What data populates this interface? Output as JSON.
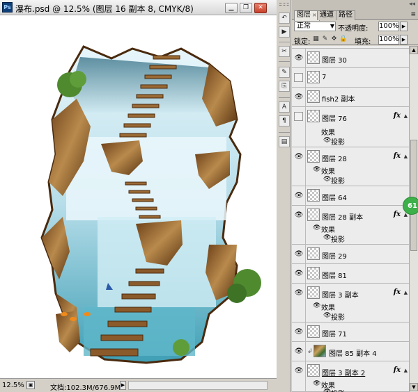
{
  "document": {
    "title": "瀑布.psd @ 12.5% (图层 16 副本 8, CMYK/8)",
    "app_icon_label": "Ps",
    "status": {
      "zoom": "12.5%",
      "doc_size": "文档:102.3M/676.9M"
    }
  },
  "panel": {
    "tabs": [
      {
        "label": "图层",
        "close": "×"
      },
      {
        "label": "通道"
      },
      {
        "label": "路径"
      }
    ],
    "blend_mode": "正常",
    "opacity_label": "不透明度:",
    "opacity_value": "100%",
    "lock_label": "锁定:",
    "fill_label": "填充:",
    "fill_value": "100%",
    "effects_label": "效果",
    "drop_shadow_label": "投影"
  },
  "layers": [
    {
      "name": "图层 30",
      "visible": true,
      "fx": false
    },
    {
      "name": "7",
      "visible": false,
      "fx": false
    },
    {
      "name": "fish2 副本",
      "visible": true,
      "fx": false
    },
    {
      "name": "图层 76",
      "visible": false,
      "fx": true
    },
    {
      "name": "图层 28",
      "visible": true,
      "fx": true
    },
    {
      "name": "图层 64",
      "visible": true,
      "fx": false
    },
    {
      "name": "图层 28 副本",
      "visible": true,
      "fx": true
    },
    {
      "name": "图层 29",
      "visible": true,
      "fx": false
    },
    {
      "name": "图层 81",
      "visible": true,
      "fx": false
    },
    {
      "name": "图层 3 副本",
      "visible": true,
      "fx": true
    },
    {
      "name": "图层 71",
      "visible": true,
      "fx": false
    },
    {
      "name": "图层 85 副本 4",
      "visible": true,
      "fx": false
    },
    {
      "name": "图层 3 副本 2",
      "visible": true,
      "fx": true
    }
  ],
  "fx_label": "fx",
  "badge_value": "61",
  "colors": {
    "panel_bg": "#d4d0c8",
    "layer_bg": "#ececec",
    "sky_blue": "#9fd0e8",
    "water": "#c8e8f2",
    "rock": "#a87a3e",
    "wood": "#8a5a2b",
    "foliage": "#4f8a2f",
    "badge": "#3db04a"
  },
  "icons": [
    "photoshop-app-icon",
    "minimize-icon",
    "restore-icon",
    "close-icon",
    "eye-icon",
    "chain-link-icon",
    "lock-transparency-icon",
    "lock-brush-icon",
    "lock-move-icon",
    "lock-all-icon",
    "scroll-up-icon",
    "scroll-down-icon",
    "panel-menu-icon"
  ]
}
